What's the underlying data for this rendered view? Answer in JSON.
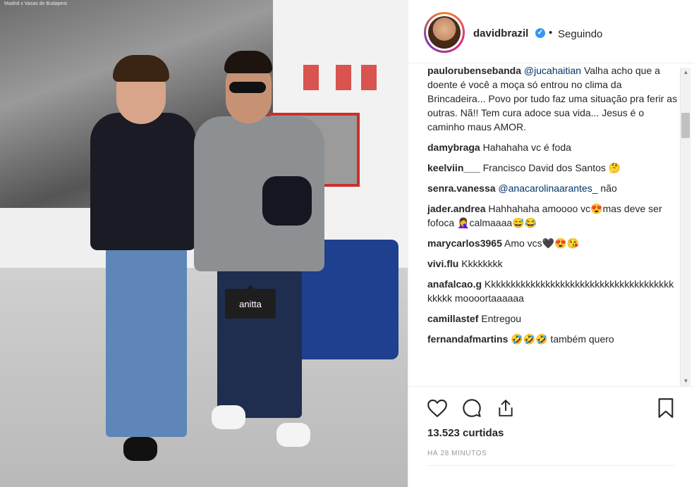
{
  "photo": {
    "mural_caption": "Madrid x Vasas de Budapest",
    "tag_label": "anitta"
  },
  "post": {
    "username": "davidbrazil",
    "verified_icon": "verified-badge-icon",
    "follow_status": "Seguindo",
    "likes": "13.523 curtidas",
    "time": "HÁ 28 MINUTOS"
  },
  "comments": [
    {
      "user": "paulorubensebanda",
      "mention": "@jucahaitian",
      "text": " Valha acho que a doente é você a moça só entrou no clima da Brincadeira... Povo por tudo faz uma situação pra ferir as outras. Nã!! Tem cura adoce sua vida... Jesus é o caminho maus AMOR."
    },
    {
      "user": "damybraga",
      "mention": "",
      "text": " Hahahaha vc é foda"
    },
    {
      "user": "keelviin___",
      "mention": "",
      "text": " Francisco David dos Santos 🤔"
    },
    {
      "user": "senra.vanessa",
      "mention": "@anacarolinaarantes_",
      "text": " não"
    },
    {
      "user": "jader.andrea",
      "mention": "",
      "text": " Hahhahaha amoooo vc😍mas deve ser fofoca 🤦‍♀️calmaaaa😅😂"
    },
    {
      "user": "marycarlos3965",
      "mention": "",
      "text": " Amo vcs🖤😍😘"
    },
    {
      "user": "vivi.flu",
      "mention": "",
      "text": " Kkkkkkkk"
    },
    {
      "user": "anafalcao.g",
      "mention": "",
      "text": " Kkkkkkkkkkkkkkkkkkkkkkkkkkkkkkkkkkkkkkkkkkk moooortaaaaaa"
    },
    {
      "user": "camillastef",
      "mention": "",
      "text": " Entregou"
    },
    {
      "user": "fernandafmartins",
      "mention": "",
      "text": " 🤣🤣🤣 também quero"
    }
  ],
  "actions": {
    "like_icon": "heart-icon",
    "comment_icon": "comment-icon",
    "share_icon": "share-icon",
    "save_icon": "bookmark-icon"
  },
  "colors": {
    "verified": "#3897f0",
    "mention": "#003569",
    "chair": "#1f3f8f"
  }
}
